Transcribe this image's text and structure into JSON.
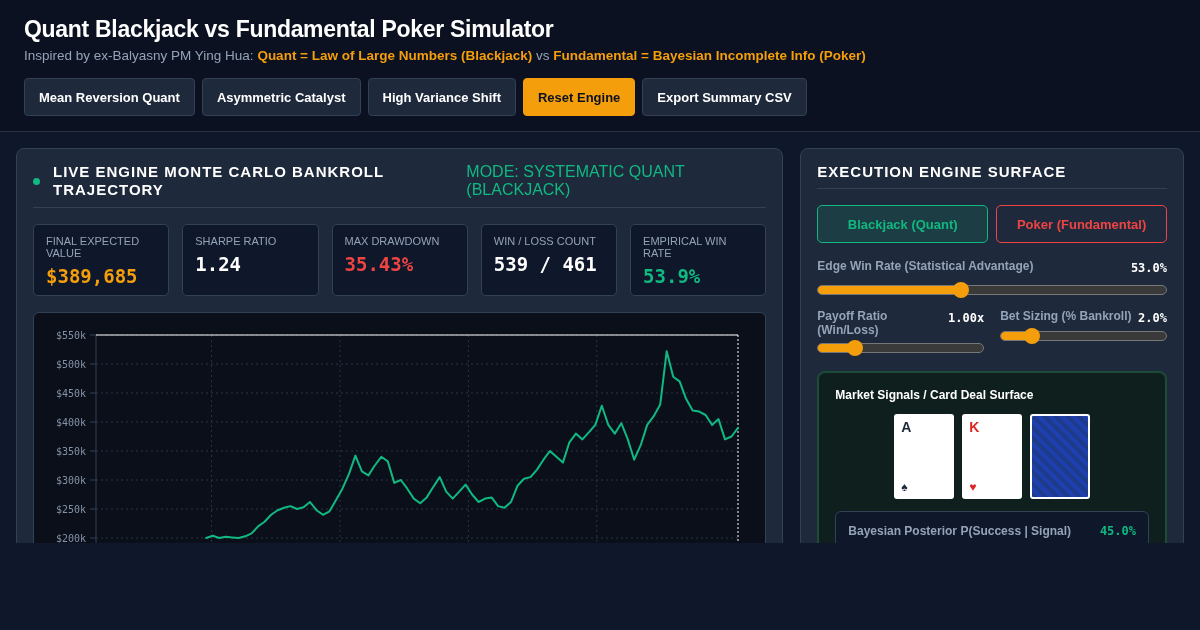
{
  "header": {
    "title": "Quant Blackjack vs Fundamental Poker Simulator",
    "subtitle": "Inspired by ex-Balyasny PM Ying Hua: **Quant = Law of Large Numbers (Blackjack)** vs **Fundamental = Bayesian Incomplete Info (Poker)**",
    "buttons": [
      {
        "label": "Mean Reversion Quant",
        "primary": false
      },
      {
        "label": "Asymmetric Catalyst",
        "primary": false
      },
      {
        "label": "High Variance Shift",
        "primary": false
      },
      {
        "label": "Reset Engine",
        "primary": true
      },
      {
        "label": "Export Summary CSV",
        "primary": false
      }
    ]
  },
  "trajectory_panel": {
    "title": "LIVE ENGINE MONTE CARLO BANKROLL TRAJECTORY",
    "mode": "MODE: SYSTEMATIC QUANT (BLACKJACK)",
    "metrics": [
      {
        "label": "FINAL EXPECTED VALUE",
        "value": "$389,685",
        "color": "#f59e0b"
      },
      {
        "label": "SHARPE RATIO",
        "value": "1.24",
        "color": "#ffffff"
      },
      {
        "label": "MAX DRAWDOWN",
        "value": "35.43%",
        "color": "#ef4444"
      },
      {
        "label": "WIN / LOSS COUNT",
        "value": "539 / 461",
        "color": "#ffffff"
      },
      {
        "label": "EMPIRICAL WIN RATE",
        "value": "53.9%",
        "color": "#10b981"
      }
    ],
    "chart_data": {
      "type": "line",
      "grid": true,
      "ylim": [
        200000,
        550000
      ],
      "yticks": [
        {
          "value": 200000,
          "label": "$200k"
        },
        {
          "value": 250000,
          "label": "$250k"
        },
        {
          "value": 300000,
          "label": "$300k"
        },
        {
          "value": 350000,
          "label": "$350k"
        },
        {
          "value": 400000,
          "label": "$400k"
        },
        {
          "value": 450000,
          "label": "$450k"
        },
        {
          "value": 500000,
          "label": "$500k"
        },
        {
          "value": 550000,
          "label": "$550k"
        }
      ],
      "series": [
        {
          "color": "#10b981",
          "values": [
            null,
            null,
            null,
            null,
            null,
            null,
            null,
            null,
            null,
            null,
            null,
            null,
            null,
            null,
            null,
            null,
            null,
            200000,
            204000,
            200000,
            202000,
            201000,
            200000,
            203000,
            208000,
            220000,
            228000,
            240000,
            248000,
            252000,
            255000,
            250000,
            253000,
            262000,
            248000,
            240000,
            246000,
            265000,
            285000,
            310000,
            342000,
            315000,
            308000,
            325000,
            340000,
            332000,
            295000,
            300000,
            285000,
            268000,
            260000,
            270000,
            288000,
            305000,
            280000,
            268000,
            280000,
            292000,
            275000,
            262000,
            268000,
            270000,
            255000,
            252000,
            262000,
            290000,
            302000,
            305000,
            318000,
            335000,
            350000,
            340000,
            330000,
            365000,
            380000,
            370000,
            382000,
            395000,
            428000,
            395000,
            380000,
            398000,
            370000,
            335000,
            360000,
            395000,
            410000,
            430000,
            522000,
            478000,
            470000,
            440000,
            420000,
            418000,
            412000,
            395000,
            405000,
            370000,
            375000,
            390000
          ]
        }
      ]
    }
  },
  "engine_panel": {
    "title": "EXECUTION ENGINE SURFACE",
    "modes": [
      {
        "label": "Blackjack (Quant)",
        "selected": true
      },
      {
        "label": "Poker (Fundamental)",
        "selected": false
      }
    ],
    "sliders": [
      {
        "label": "Edge Win Rate (Statistical Advantage)",
        "reading": "53.0%",
        "level": 0.41
      },
      {
        "label": "Payoff Ratio (Win/Loss)",
        "reading": "1.00x",
        "level": 0.22
      },
      {
        "label": "Bet Sizing (% Bankroll)",
        "reading": "2.0%",
        "level": 0.19
      }
    ],
    "deal_surface": {
      "title": "Market Signals / Card Deal Surface",
      "cards": [
        {
          "kind": "face",
          "rank": "A",
          "suit": "♠",
          "color": "#1e293b"
        },
        {
          "kind": "face",
          "rank": "K",
          "suit": "♥",
          "color": "#dc2626"
        },
        {
          "kind": "back"
        }
      ],
      "posterior": {
        "label": "Bayesian Posterior P(Success | Signal)",
        "value": "45.0%"
      }
    }
  }
}
